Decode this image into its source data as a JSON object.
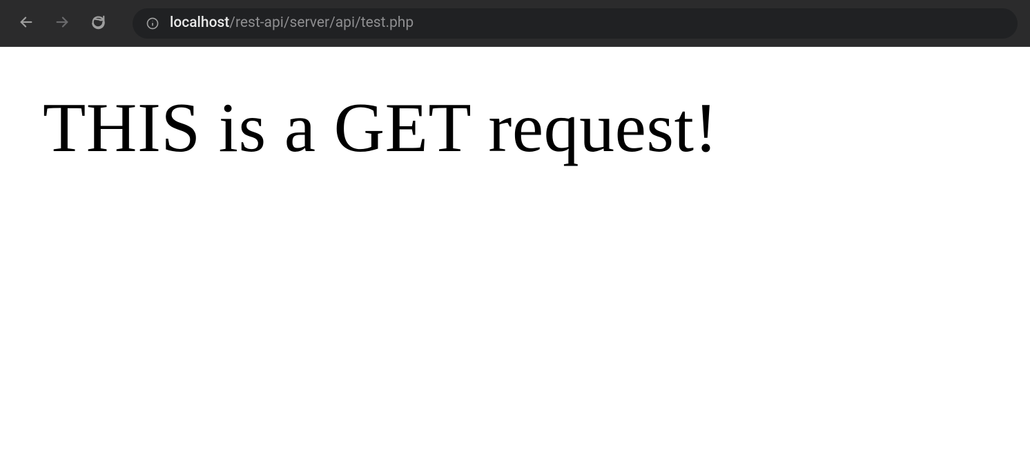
{
  "browser": {
    "url": {
      "host": "localhost",
      "path": "/rest-api/server/api/test.php"
    },
    "icons": {
      "back": "back-arrow",
      "forward": "forward-arrow",
      "reload": "reload",
      "info": "info-circle"
    }
  },
  "page": {
    "heading": "THIS is a GET request!"
  }
}
